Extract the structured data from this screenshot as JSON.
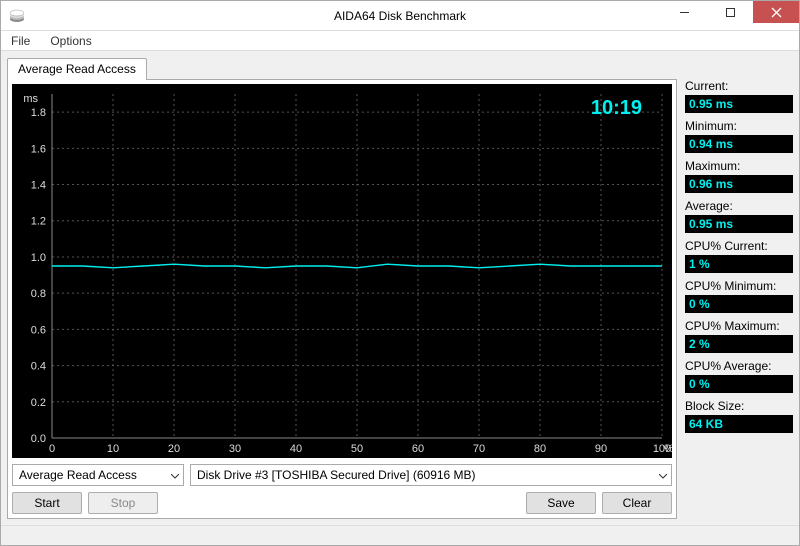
{
  "window": {
    "title": "AIDA64 Disk Benchmark"
  },
  "menu": {
    "file": "File",
    "options": "Options"
  },
  "tab": {
    "label": "Average Read Access"
  },
  "chart_data": {
    "type": "line",
    "title": "",
    "xlabel": "%",
    "ylabel": "ms",
    "xlim": [
      0,
      100
    ],
    "ylim": [
      0.0,
      1.9
    ],
    "x_ticks": [
      0,
      10,
      20,
      30,
      40,
      50,
      60,
      70,
      80,
      90,
      100
    ],
    "y_ticks": [
      0.0,
      0.2,
      0.4,
      0.6,
      0.8,
      1.0,
      1.2,
      1.4,
      1.6,
      1.8
    ],
    "y_unit": "ms",
    "x_unit": "%",
    "annotation": "10:19",
    "series": [
      {
        "name": "Average Read Access",
        "x": [
          0,
          5,
          10,
          15,
          20,
          25,
          30,
          35,
          40,
          45,
          50,
          55,
          60,
          65,
          70,
          75,
          80,
          85,
          90,
          95,
          100
        ],
        "values": [
          0.95,
          0.95,
          0.94,
          0.95,
          0.96,
          0.95,
          0.95,
          0.94,
          0.95,
          0.95,
          0.94,
          0.96,
          0.95,
          0.95,
          0.94,
          0.95,
          0.96,
          0.95,
          0.95,
          0.95,
          0.95
        ]
      }
    ]
  },
  "controls": {
    "test_type": "Average Read Access",
    "drive": "Disk Drive #3  [TOSHIBA Secured Drive]  (60916 MB)"
  },
  "buttons": {
    "start": "Start",
    "stop": "Stop",
    "save": "Save",
    "clear": "Clear"
  },
  "stats": {
    "current_label": "Current:",
    "current_value": "0.95 ms",
    "minimum_label": "Minimum:",
    "minimum_value": "0.94 ms",
    "maximum_label": "Maximum:",
    "maximum_value": "0.96 ms",
    "average_label": "Average:",
    "average_value": "0.95 ms",
    "cpu_current_label": "CPU% Current:",
    "cpu_current_value": "1 %",
    "cpu_minimum_label": "CPU% Minimum:",
    "cpu_minimum_value": "0 %",
    "cpu_maximum_label": "CPU% Maximum:",
    "cpu_maximum_value": "2 %",
    "cpu_average_label": "CPU% Average:",
    "cpu_average_value": "0 %",
    "block_size_label": "Block Size:",
    "block_size_value": "64 KB"
  }
}
